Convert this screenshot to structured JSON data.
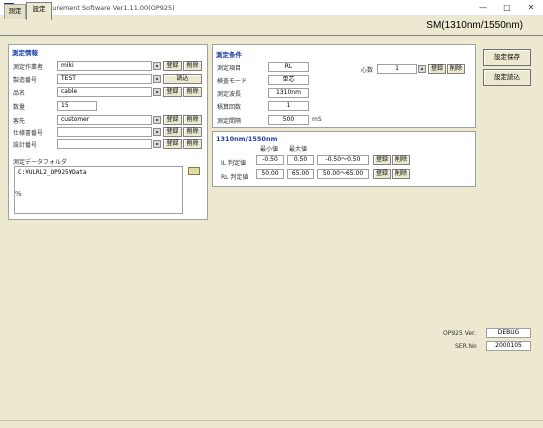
{
  "window": {
    "title": "ULKL Measurement Software Ver1.11.00(OP925)",
    "minimize": "—",
    "maximize": "□",
    "close": "✕"
  },
  "tabs": [
    {
      "label": "測定",
      "active": false
    },
    {
      "label": "設定",
      "active": true
    }
  ],
  "mode_label": "SM(1310nm/1550nm)",
  "measurement_info": {
    "title": "測定情報",
    "rows": [
      {
        "label": "測定作業者",
        "value": "miki"
      },
      {
        "label": "製造番号",
        "value": "TEST"
      },
      {
        "label": "品名",
        "value": "cable"
      },
      {
        "label": "数量",
        "value": "15"
      },
      {
        "label": "客先",
        "value": "customer"
      },
      {
        "label": "仕様書番号",
        "value": ""
      },
      {
        "label": "設計番号",
        "value": ""
      }
    ],
    "register_label": "登録",
    "delete_label": "削除",
    "load_label": "読込"
  },
  "data_folder": {
    "title": "測定データフォルダ",
    "path": "C:¥ULRL2_OP925¥Data",
    "side_glyph": "%"
  },
  "measurement_conditions": {
    "title": "測定条件",
    "rows": [
      {
        "label": "測定項目",
        "value": "RL"
      },
      {
        "label": "検査モード",
        "value": "単芯"
      },
      {
        "label": "測定波長",
        "value": "1310nm"
      },
      {
        "label": "積算回数",
        "value": "1"
      },
      {
        "label": "測定間隔",
        "value": "500"
      }
    ],
    "interval_unit": "mS",
    "core_label": "心数",
    "core_value": "1",
    "register_label": "登録",
    "delete_label": "削除"
  },
  "judgement": {
    "title": "1310nm/1550nm",
    "min_header": "最小値",
    "max_header": "最大値",
    "rows": [
      {
        "label": "IL 判定値",
        "min": "-0.50",
        "max": "0.50",
        "range": "-0.50～0.50"
      },
      {
        "label": "RL 判定値",
        "min": "50.00",
        "max": "65.00",
        "range": "50.00～65.00"
      }
    ],
    "register_label": "登録",
    "delete_label": "削除"
  },
  "side_buttons": {
    "save": "設定保存",
    "load": "設定読込"
  },
  "version": {
    "op_label": "OP925 Ver.",
    "op_value": "DEBUG",
    "ser_label": "SER.No",
    "ser_value": "2000105"
  }
}
